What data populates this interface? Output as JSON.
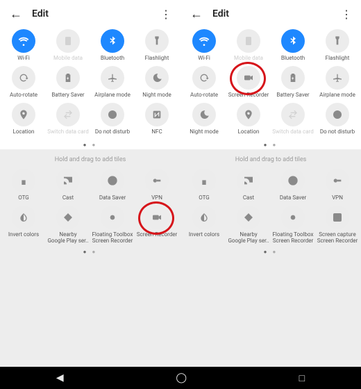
{
  "header": {
    "title": "Edit"
  },
  "hint": "Hold and drag to add tiles",
  "left": {
    "active_rows": [
      [
        {
          "name": "wifi",
          "label": "Wi-Fi",
          "active": true
        },
        {
          "name": "mobile-data",
          "label": "Mobile data",
          "faded": true
        },
        {
          "name": "bluetooth",
          "label": "Bluetooth",
          "active": true
        },
        {
          "name": "flashlight",
          "label": "Flashlight"
        }
      ],
      [
        {
          "name": "auto-rotate",
          "label": "Auto-rotate"
        },
        {
          "name": "battery-saver",
          "label": "Battery Saver"
        },
        {
          "name": "airplane-mode",
          "label": "Airplane mode"
        },
        {
          "name": "night-mode",
          "label": "Night mode"
        }
      ],
      [
        {
          "name": "location",
          "label": "Location"
        },
        {
          "name": "switch-data-card",
          "label": "Switch data card",
          "faded": true
        },
        {
          "name": "do-not-disturb",
          "label": "Do not disturb"
        },
        {
          "name": "nfc",
          "label": "NFC"
        }
      ]
    ],
    "inactive_rows": [
      [
        {
          "name": "otg",
          "label": "OTG"
        },
        {
          "name": "cast",
          "label": "Cast"
        },
        {
          "name": "data-saver",
          "label": "Data Saver"
        },
        {
          "name": "vpn",
          "label": "VPN"
        }
      ],
      [
        {
          "name": "invert-colors",
          "label": "Invert colors"
        },
        {
          "name": "nearby",
          "label": "Nearby\nGoogle Play ser.."
        },
        {
          "name": "floating-toolbox",
          "label": "Floating Toolbox\nScreen Recorder"
        },
        {
          "name": "screen-recorder",
          "label": "Screen Recorder",
          "ring": true
        }
      ]
    ]
  },
  "right": {
    "active_rows": [
      [
        {
          "name": "wifi",
          "label": "Wi-Fi",
          "active": true
        },
        {
          "name": "mobile-data",
          "label": "Mobile data",
          "faded": true
        },
        {
          "name": "bluetooth",
          "label": "Bluetooth",
          "active": true
        },
        {
          "name": "flashlight",
          "label": "Flashlight"
        }
      ],
      [
        {
          "name": "auto-rotate",
          "label": "Auto-rotate"
        },
        {
          "name": "screen-recorder",
          "label": "Screen Recorder",
          "ring": true
        },
        {
          "name": "battery-saver",
          "label": "Battery Saver"
        },
        {
          "name": "airplane-mode",
          "label": "Airplane mode"
        }
      ],
      [
        {
          "name": "night-mode",
          "label": "Night mode"
        },
        {
          "name": "location",
          "label": "Location"
        },
        {
          "name": "switch-data-card",
          "label": "Switch data card",
          "faded": true
        },
        {
          "name": "do-not-disturb",
          "label": "Do not disturb"
        }
      ]
    ],
    "inactive_rows": [
      [
        {
          "name": "otg",
          "label": "OTG"
        },
        {
          "name": "cast",
          "label": "Cast"
        },
        {
          "name": "data-saver",
          "label": "Data Saver"
        },
        {
          "name": "vpn",
          "label": "VPN"
        }
      ],
      [
        {
          "name": "invert-colors",
          "label": "Invert colors"
        },
        {
          "name": "nearby",
          "label": "Nearby\nGoogle Play ser.."
        },
        {
          "name": "floating-toolbox",
          "label": "Floating Toolbox\nScreen Recorder"
        },
        {
          "name": "screen-capture",
          "label": "Screen capture\nScreen Recorder"
        }
      ]
    ]
  }
}
